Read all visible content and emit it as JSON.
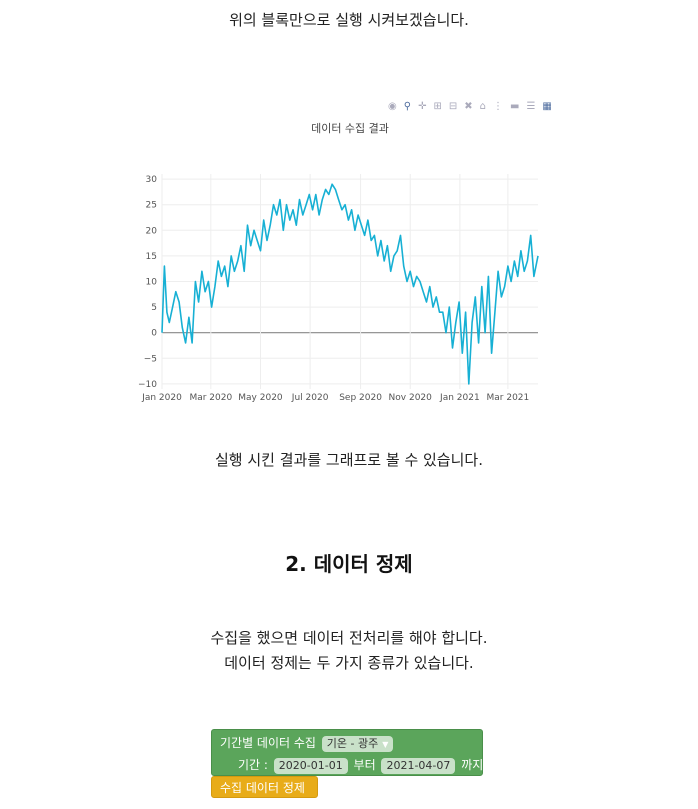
{
  "text": {
    "intro": "위의 블록만으로 실행 시켜보겠습니다.",
    "result": "실행 시킨 결과를 그래프로 볼 수 있습니다.",
    "section_title": "2. 데이터 정제",
    "desc1": "수집을 했으면 데이터 전처리를 해야 합니다.",
    "desc2": "데이터 정제는 두 가지 종류가 있습니다."
  },
  "toolbar": {
    "icons": [
      "camera-icon",
      "zoom-icon",
      "pan-icon",
      "zoom-in-icon",
      "zoom-out-icon",
      "autoscale-icon",
      "reset-axes-icon",
      "spike-lines-icon",
      "hover-closest-icon",
      "hover-compare-icon",
      "plotly-logo-icon"
    ]
  },
  "chart_data": {
    "type": "line",
    "title": "데이터 수집 결과",
    "color": "#17b0d4",
    "x_ticks": [
      "Jan 2020",
      "Mar 2020",
      "May 2020",
      "Jul 2020",
      "Sep 2020",
      "Nov 2020",
      "Jan 2021",
      "Mar 2021"
    ],
    "y_ticks": [
      30,
      25,
      20,
      15,
      10,
      5,
      0,
      -5,
      -10
    ],
    "ylim": [
      -11,
      31
    ],
    "x_start": "2020-01-01",
    "x_end": "2021-04-07",
    "grid": true,
    "series": [
      {
        "x": [
          "2020-01-01",
          "2020-01-04",
          "2020-01-07",
          "2020-01-10",
          "2020-01-14",
          "2020-01-18",
          "2020-01-22",
          "2020-01-26",
          "2020-01-30",
          "2020-02-03",
          "2020-02-07",
          "2020-02-11",
          "2020-02-15",
          "2020-02-19",
          "2020-02-23",
          "2020-02-27",
          "2020-03-02",
          "2020-03-06",
          "2020-03-10",
          "2020-03-14",
          "2020-03-18",
          "2020-03-22",
          "2020-03-26",
          "2020-03-30",
          "2020-04-03",
          "2020-04-07",
          "2020-04-11",
          "2020-04-15",
          "2020-04-19",
          "2020-04-23",
          "2020-04-27",
          "2020-05-01",
          "2020-05-05",
          "2020-05-09",
          "2020-05-13",
          "2020-05-17",
          "2020-05-21",
          "2020-05-25",
          "2020-05-29",
          "2020-06-02",
          "2020-06-06",
          "2020-06-10",
          "2020-06-14",
          "2020-06-18",
          "2020-06-22",
          "2020-06-26",
          "2020-06-30",
          "2020-07-04",
          "2020-07-08",
          "2020-07-12",
          "2020-07-16",
          "2020-07-20",
          "2020-07-24",
          "2020-07-28",
          "2020-08-01",
          "2020-08-05",
          "2020-08-09",
          "2020-08-13",
          "2020-08-17",
          "2020-08-21",
          "2020-08-25",
          "2020-08-29",
          "2020-09-02",
          "2020-09-06",
          "2020-09-10",
          "2020-09-14",
          "2020-09-18",
          "2020-09-22",
          "2020-09-26",
          "2020-09-30",
          "2020-10-04",
          "2020-10-08",
          "2020-10-12",
          "2020-10-16",
          "2020-10-20",
          "2020-10-24",
          "2020-10-28",
          "2020-11-01",
          "2020-11-05",
          "2020-11-09",
          "2020-11-13",
          "2020-11-17",
          "2020-11-21",
          "2020-11-25",
          "2020-11-29",
          "2020-12-03",
          "2020-12-07",
          "2020-12-11",
          "2020-12-15",
          "2020-12-19",
          "2020-12-23",
          "2020-12-27",
          "2020-12-31",
          "2021-01-04",
          "2021-01-08",
          "2021-01-12",
          "2021-01-16",
          "2021-01-20",
          "2021-01-24",
          "2021-01-28",
          "2021-02-01",
          "2021-02-05",
          "2021-02-09",
          "2021-02-13",
          "2021-02-17",
          "2021-02-21",
          "2021-02-25",
          "2021-03-01",
          "2021-03-05",
          "2021-03-09",
          "2021-03-13",
          "2021-03-17",
          "2021-03-21",
          "2021-03-25",
          "2021-03-29",
          "2021-04-02",
          "2021-04-07"
        ],
        "y": [
          0,
          13,
          4,
          2,
          5,
          8,
          6,
          1,
          -2,
          3,
          -2,
          10,
          6,
          12,
          8,
          10,
          5,
          9,
          14,
          11,
          13,
          9,
          15,
          12,
          14,
          17,
          12,
          21,
          17,
          20,
          18,
          16,
          22,
          18,
          21,
          25,
          23,
          26,
          20,
          25,
          22,
          24,
          21,
          26,
          23,
          25,
          27,
          24,
          27,
          23,
          26,
          28,
          27,
          29,
          28,
          26,
          24,
          25,
          22,
          24,
          20,
          23,
          21,
          19,
          22,
          18,
          19,
          15,
          18,
          14,
          17,
          12,
          15,
          16,
          19,
          13,
          10,
          12,
          9,
          11,
          10,
          8,
          6,
          9,
          5,
          7,
          4,
          4,
          0,
          5,
          -3,
          2,
          6,
          -4,
          4,
          -10,
          2,
          7,
          -2,
          9,
          0,
          11,
          -4,
          4,
          12,
          7,
          9,
          13,
          10,
          14,
          11,
          16,
          12,
          14,
          19,
          11,
          15
        ]
      }
    ]
  },
  "blocks": {
    "collect_label": "기간별 데이터 수집",
    "region": "기온 - 광주",
    "period_label": "기간 :",
    "start": "2020-01-01",
    "from_label": "부터",
    "end": "2021-04-07",
    "until_label": "까지",
    "refine_label": "수집 데이터 정제"
  }
}
